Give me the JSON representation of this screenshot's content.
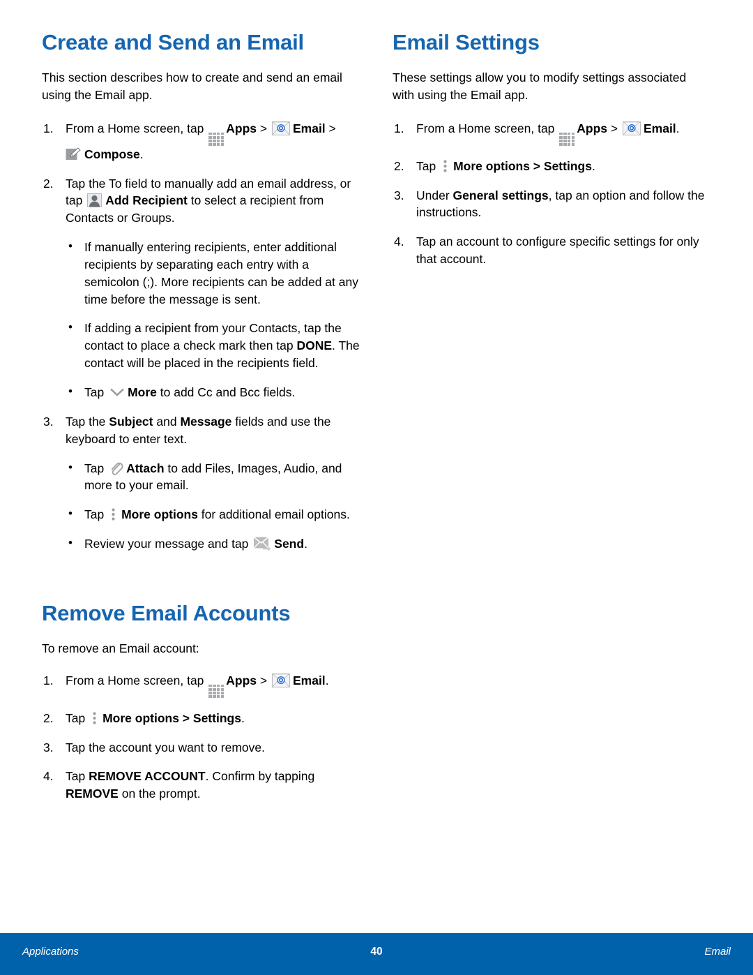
{
  "page": {
    "number": "40",
    "footer_left": "Applications",
    "footer_right": "Email",
    "heading_color": "#1565b0",
    "footer_color": "#0062ab"
  },
  "left_column": {
    "section1": {
      "title": "Create and Send an Email",
      "intro": "This section describes how to create and send an email using the Email app.",
      "step1": {
        "num": "1.",
        "t1": "From a Home screen, tap ",
        "apps": "Apps",
        "gt1": " > ",
        "email": "Email",
        "gt2": " > ",
        "compose": "Compose",
        "end": "."
      },
      "step2": {
        "num": "2.",
        "t1": "Tap the To field to manually add an email address, or tap ",
        "add_recipient": "Add Recipient",
        "t2": " to select a recipient from Contacts or Groups.",
        "bullets": {
          "b1": "If manually entering recipients, enter additional recipients by separating each entry with a semicolon (;). More recipients can be added at any time before the message is sent.",
          "b2_t1": "If adding a recipient from your Contacts, tap the contact to place a check mark then tap ",
          "b2_done": "DONE",
          "b2_t2": ". The contact will be placed in the recipients field.",
          "b3_t1": "Tap ",
          "b3_more": "More",
          "b3_t2": " to add Cc and Bcc fields."
        }
      },
      "step3": {
        "num": "3.",
        "t1": "Tap the ",
        "subject": "Subject",
        "t2": " and ",
        "message": "Message",
        "t3": " fields and use the keyboard to enter text.",
        "bullets": {
          "b1_t1": "Tap ",
          "b1_attach": "Attach",
          "b1_t2": " to add Files, Images, Audio, and more to your email.",
          "b2_t1": "Tap ",
          "b2_more_options": "More options",
          "b2_t2": " for additional email options.",
          "b3_t1": "Review your message and tap ",
          "b3_send": "Send",
          "b3_t2": "."
        }
      }
    },
    "section2": {
      "title": "Remove Email Accounts",
      "intro": "To remove an Email account:",
      "step1": {
        "num": "1.",
        "t1": "From a Home screen, tap ",
        "apps": "Apps",
        "gt1": " > ",
        "email": "Email",
        "end": "."
      },
      "step2": {
        "num": "2.",
        "t1": "Tap ",
        "more_options": "More options",
        "gt": " > ",
        "settings": "Settings",
        "end": "."
      },
      "step3": {
        "num": "3.",
        "t1": "Tap the account you want to remove."
      },
      "step4": {
        "num": "4.",
        "t1": "Tap ",
        "remove_account": "REMOVE ACCOUNT",
        "t2": ". Confirm by tapping ",
        "remove": "REMOVE",
        "t3": " on the prompt."
      }
    }
  },
  "right_column": {
    "section1": {
      "title": "Email Settings",
      "intro": "These settings allow you to modify settings associated with using the Email app.",
      "step1": {
        "num": "1.",
        "t1": "From a Home screen, tap ",
        "apps": "Apps",
        "gt1": " > ",
        "email": "Email",
        "end": "."
      },
      "step2": {
        "num": "2.",
        "t1": "Tap ",
        "more_options": "More options",
        "gt": " > ",
        "settings": "Settings",
        "end": "."
      },
      "step3": {
        "num": "3.",
        "t1": "Under ",
        "general_settings": "General settings",
        "t2": ", tap an option and follow the instructions."
      },
      "step4": {
        "num": "4.",
        "t1": "Tap an account to configure specific settings for only that account."
      }
    }
  }
}
